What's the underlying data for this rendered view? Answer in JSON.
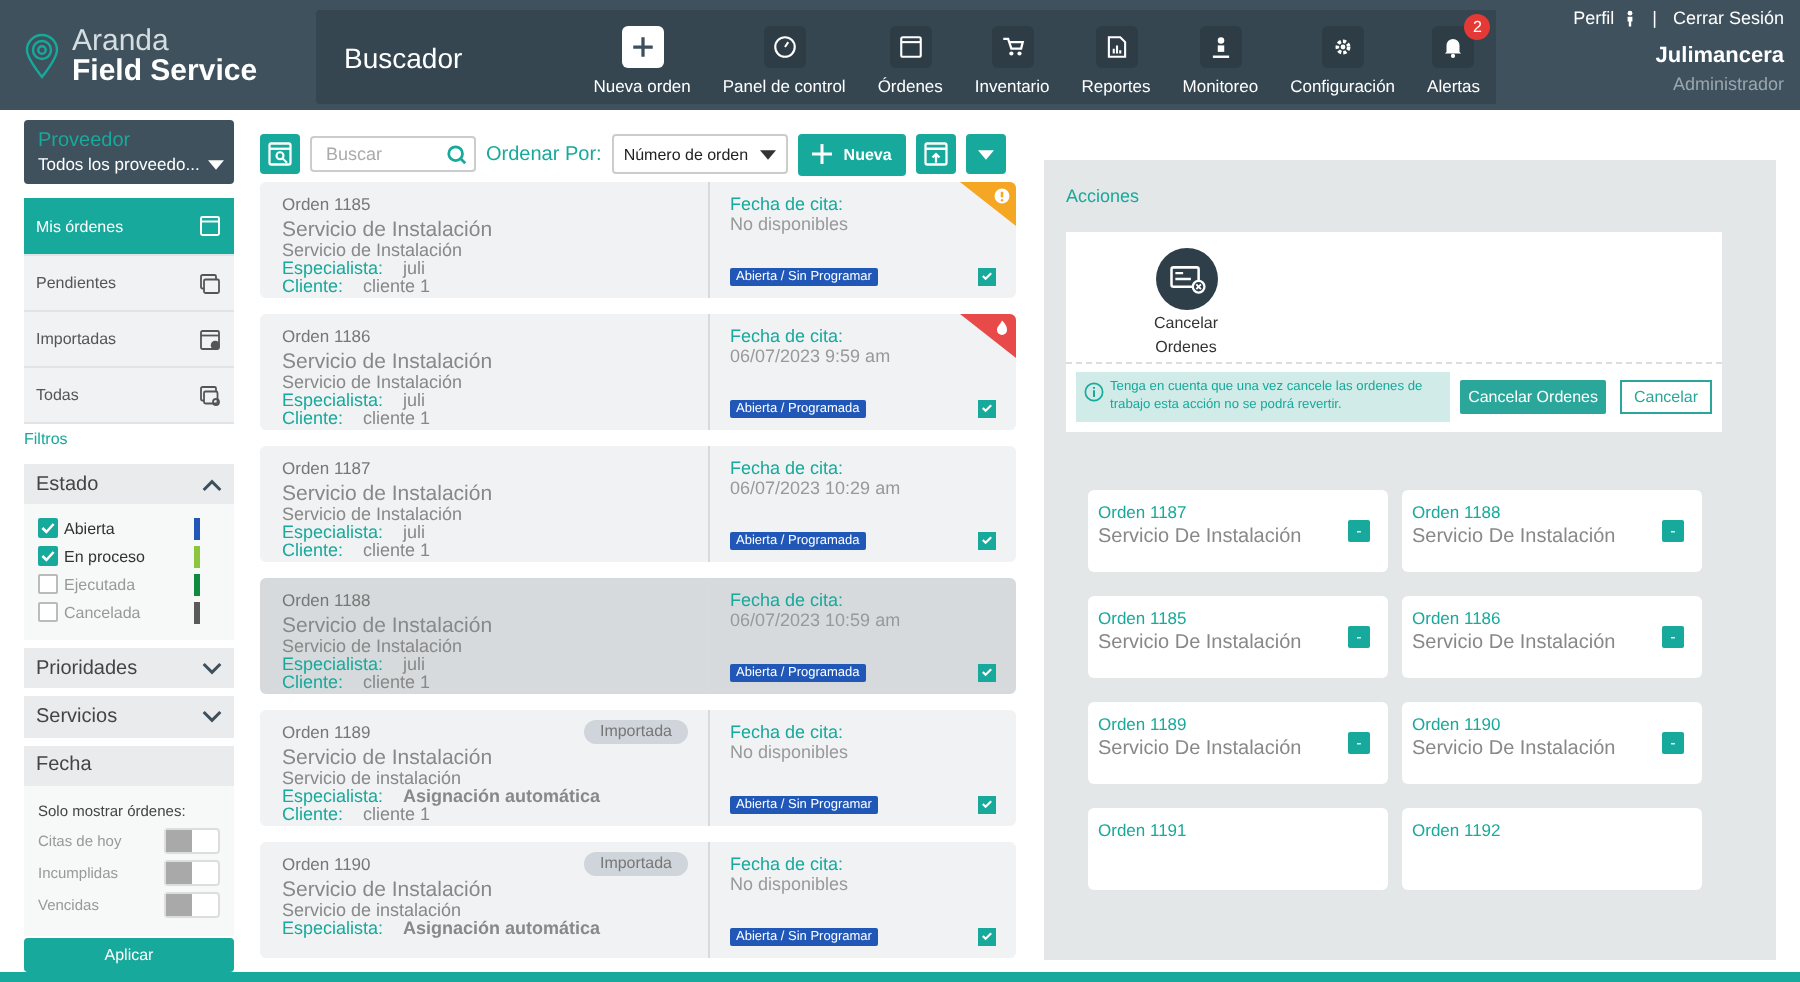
{
  "header": {
    "logo": {
      "line1": "Aranda",
      "line2": "Field Service"
    },
    "page_title": "Buscador",
    "nav": [
      {
        "label": "Nueva orden",
        "kind": "plus",
        "primary": true
      },
      {
        "label": "Panel de control",
        "kind": "gauge",
        "primary": false
      },
      {
        "label": "Órdenes",
        "kind": "window",
        "primary": false
      },
      {
        "label": "Inventario",
        "kind": "cart",
        "primary": false
      },
      {
        "label": "Reportes",
        "kind": "report",
        "primary": false
      },
      {
        "label": "Monitoreo",
        "kind": "person",
        "primary": false
      },
      {
        "label": "Configuración",
        "kind": "gear",
        "primary": false
      },
      {
        "label": "Alertas",
        "kind": "bell",
        "primary": false,
        "badge": "2"
      }
    ],
    "user": {
      "profile_link": "Perfil",
      "separator": "|",
      "logout_link": "Cerrar Sesión",
      "name": "Julimancera",
      "role": "Administrador"
    }
  },
  "sidebar": {
    "provider": {
      "label": "Proveedor",
      "value": "Todos los proveedo..."
    },
    "views": [
      {
        "label": "Mis órdenes",
        "kind": "window",
        "selected": true
      },
      {
        "label": "Pendientes",
        "kind": "stack",
        "selected": false
      },
      {
        "label": "Importadas",
        "kind": "import",
        "selected": false
      },
      {
        "label": "Todas",
        "kind": "stack-search",
        "selected": false
      }
    ],
    "filters_title": "Filtros",
    "sections": [
      {
        "kind": "checklist",
        "title": "Estado",
        "expanded": true,
        "items": [
          {
            "label": "Abierta",
            "checked": true,
            "color": "#2158b8"
          },
          {
            "label": "En proceso",
            "checked": true,
            "color": "#8cc63f"
          },
          {
            "label": "Ejecutada",
            "checked": false,
            "color": "#108a3e"
          },
          {
            "label": "Cancelada",
            "checked": false,
            "color": "#5a5a5a"
          }
        ]
      },
      {
        "kind": "collapsed",
        "title": "Prioridades",
        "expanded": false
      },
      {
        "kind": "collapsed",
        "title": "Servicios",
        "expanded": false
      },
      {
        "kind": "toggles",
        "title": "Fecha",
        "subtitle": "Solo mostrar órdenes:",
        "items": [
          {
            "label": "Citas de hoy",
            "on": false
          },
          {
            "label": "Incumplidas",
            "on": false
          },
          {
            "label": "Vencidas",
            "on": false
          }
        ]
      }
    ],
    "apply_button": "Aplicar"
  },
  "toolbar": {
    "search": {
      "placeholder": "Buscar"
    },
    "sort_label": "Ordenar Por:",
    "sort_value": "Número de orden",
    "new_button": "Nueva"
  },
  "orders": [
    {
      "number": "Orden 1185",
      "title": "Servicio de Instalación",
      "subtitle": "Servicio de Instalación",
      "specialist_label": "Especialista:",
      "specialist": "juli",
      "specialist_auto": false,
      "client_label": "Cliente:",
      "client": "cliente 1",
      "date_label": "Fecha de cita:",
      "date": "No disponibles",
      "status": "Abierta / Sin Programar",
      "checked": true,
      "kind": "warning",
      "selected": false
    },
    {
      "number": "Orden 1186",
      "title": "Servicio de Instalación",
      "subtitle": "Servicio de Instalación",
      "specialist_label": "Especialista:",
      "specialist": "juli",
      "specialist_auto": false,
      "client_label": "Cliente:",
      "client": "cliente 1",
      "date_label": "Fecha de cita:",
      "date": "06/07/2023 9:59 am",
      "status": "Abierta / Programada",
      "checked": true,
      "kind": "urgent",
      "selected": false
    },
    {
      "number": "Orden 1187",
      "title": "Servicio de Instalación",
      "subtitle": "Servicio de Instalación",
      "specialist_label": "Especialista:",
      "specialist": "juli",
      "specialist_auto": false,
      "client_label": "Cliente:",
      "client": "cliente 1",
      "date_label": "Fecha de cita:",
      "date": "06/07/2023 10:29 am",
      "status": "Abierta / Programada",
      "checked": true,
      "selected": false
    },
    {
      "number": "Orden 1188",
      "title": "Servicio de Instalación",
      "subtitle": "Servicio de Instalación",
      "specialist_label": "Especialista:",
      "specialist": "juli",
      "specialist_auto": false,
      "client_label": "Cliente:",
      "client": "cliente 1",
      "date_label": "Fecha de cita:",
      "date": "06/07/2023 10:59 am",
      "status": "Abierta / Programada",
      "checked": true,
      "selected": true
    },
    {
      "number": "Orden 1189",
      "tag": "Importada",
      "title": "Servicio de Instalación",
      "subtitle": "Servicio de instalación",
      "specialist_label": "Especialista:",
      "specialist": "Asignación automática",
      "specialist_auto": true,
      "client_label": "Cliente:",
      "client": "cliente 1",
      "date_label": "Fecha de cita:",
      "date": "No disponibles",
      "status": "Abierta / Sin Programar",
      "checked": true,
      "selected": false
    },
    {
      "number": "Orden 1190",
      "tag": "Importada",
      "title": "Servicio de Instalación",
      "subtitle": "Servicio de instalación",
      "specialist_label": "Especialista:",
      "specialist": "Asignación automática",
      "specialist_auto": true,
      "date_label": "Fecha de cita:",
      "date": "No disponibles",
      "status": "Abierta / Sin Programar",
      "checked": true,
      "selected": false
    }
  ],
  "actions": {
    "title": "Acciones",
    "action": {
      "label": "Cancelar Ordenes"
    },
    "notice": "Tenga en cuenta que una vez cancele las ordenes de trabajo esta acción no se podrá revertir.",
    "confirm_button": "Cancelar Ordenes",
    "cancel_button": "Cancelar",
    "selected_orders": [
      {
        "number": "Orden 1187",
        "service": "Servicio De Instalación",
        "remove": "-"
      },
      {
        "number": "Orden 1188",
        "service": "Servicio De Instalación",
        "remove": "-"
      },
      {
        "number": "Orden 1185",
        "service": "Servicio De Instalación",
        "remove": "-"
      },
      {
        "number": "Orden 1186",
        "service": "Servicio De Instalación",
        "remove": "-"
      },
      {
        "number": "Orden 1189",
        "service": "Servicio De Instalación",
        "remove": "-"
      },
      {
        "number": "Orden 1190",
        "service": "Servicio De Instalación",
        "remove": "-"
      },
      {
        "number": "Orden 1191"
      },
      {
        "number": "Orden 1192"
      }
    ]
  }
}
